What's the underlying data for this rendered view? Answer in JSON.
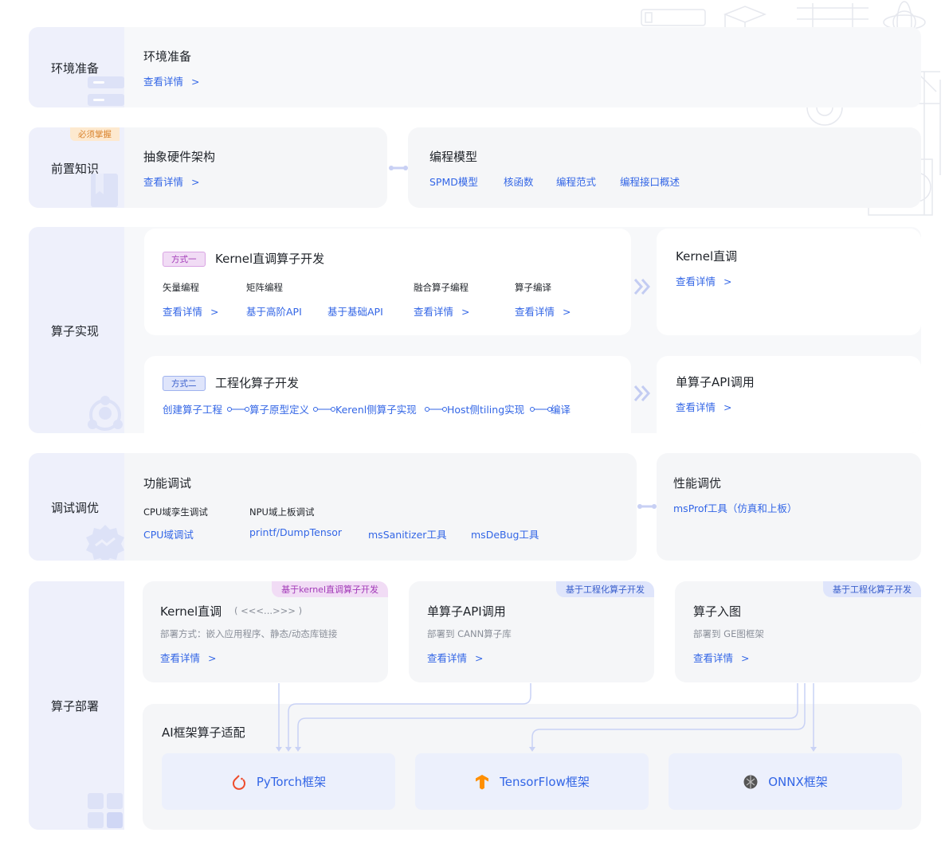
{
  "env": {
    "side_label": "环境准备",
    "card": {
      "title": "环境准备",
      "link": "查看详情",
      "chev": ">"
    }
  },
  "pre": {
    "side_label": "前置知识",
    "badge": "必须掌握",
    "hw": {
      "title": "抽象硬件架构",
      "link": "查看详情",
      "chev": ">"
    },
    "prog": {
      "title": "编程模型",
      "links": [
        "SPMD模型",
        "核函数",
        "编程范式",
        "编程接口概述"
      ]
    }
  },
  "impl": {
    "side_label": "算子实现",
    "way1": {
      "tag": "方式一",
      "title": "Kernel直调算子开发",
      "groups": [
        {
          "label": "矢量编程",
          "links": [
            "查看详情"
          ]
        },
        {
          "label": "矩阵编程",
          "links": [
            "基于高阶API",
            "基于基础API"
          ]
        },
        {
          "label": "融合算子编程",
          "links": [
            "查看详情"
          ]
        },
        {
          "label": "算子编译",
          "links": [
            "查看详情"
          ]
        }
      ],
      "chev": ">"
    },
    "way1_right": {
      "title": "Kernel直调",
      "link": "查看详情",
      "chev": ">"
    },
    "way2": {
      "tag": "方式二",
      "title": "工程化算子开发",
      "steps": [
        "创建算子工程",
        "算子原型定义",
        "Kerenl侧算子实现",
        "Host侧tiling实现",
        "编译"
      ]
    },
    "way2_right": {
      "title": "单算子API调用",
      "link": "查看详情",
      "chev": ">"
    }
  },
  "debug": {
    "side_label": "调试调优",
    "func": {
      "title": "功能调试",
      "cpu": {
        "label": "CPU域孪生调试",
        "links": [
          "CPU域调试"
        ]
      },
      "npu": {
        "label": "NPU域上板调试",
        "links": [
          "printf/DumpTensor",
          "msSanitizer工具",
          "msDeBug工具"
        ]
      }
    },
    "perf": {
      "title": "性能调优",
      "link": "msProf工具（仿真和上板）"
    }
  },
  "deploy": {
    "side_label": "算子部署",
    "cards": [
      {
        "corner": "基于kernel直调算子开发",
        "title": "Kernel直调",
        "extra": "( <<<...>>> )",
        "desc": "部署方式：嵌入应用程序、静态/动态库链接",
        "link": "查看详情",
        "chev": ">"
      },
      {
        "corner": "基于工程化算子开发",
        "title": "单算子API调用",
        "extra": "",
        "desc": "部署到 CANN算子库",
        "link": "查看详情",
        "chev": ">"
      },
      {
        "corner": "基于工程化算子开发",
        "title": "算子入图",
        "extra": "",
        "desc": "部署到 GE图框架",
        "link": "查看详情",
        "chev": ">"
      }
    ],
    "ai": {
      "title": "AI框架算子适配",
      "frameworks": [
        {
          "name": "PyTorch框架",
          "icon": "pytorch-icon",
          "color": "#ee4c2c"
        },
        {
          "name": "TensorFlow框架",
          "icon": "tensorflow-icon",
          "color": "#ff8f00"
        },
        {
          "name": "ONNX框架",
          "icon": "onnx-icon",
          "color": "#555555"
        }
      ]
    }
  }
}
